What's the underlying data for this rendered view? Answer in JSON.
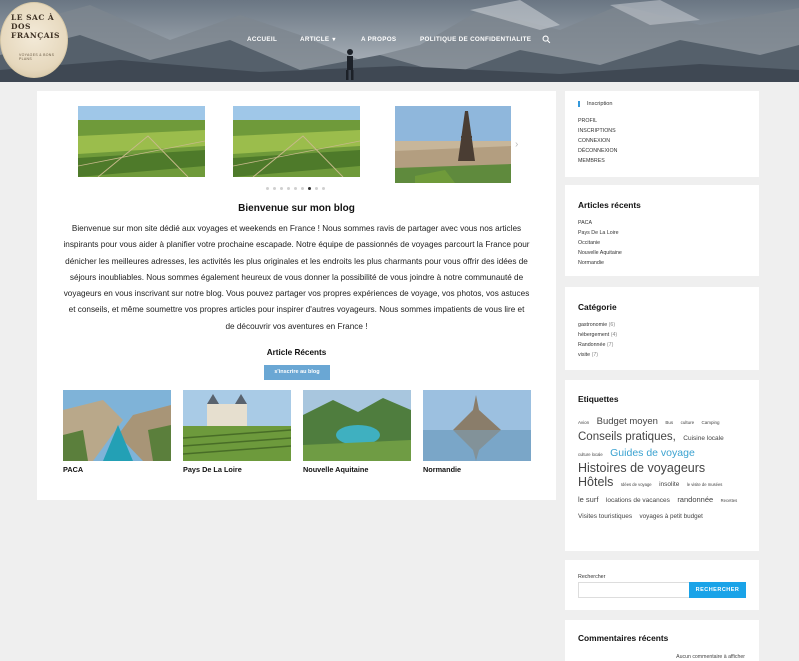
{
  "logo": {
    "text": "LE SAC À DOS FRANÇAIS",
    "subtitle": "VOYAGES & BONS PLANS"
  },
  "nav": {
    "items": [
      {
        "label": "ACCUEIL"
      },
      {
        "label": "ARTICLE"
      },
      {
        "label": "A PROPOS"
      },
      {
        "label": "POLITIQUE DE CONFIDENTIALITE"
      }
    ],
    "search_icon": "search-icon"
  },
  "main": {
    "slider": {
      "dot_count": 9,
      "active_dot": 6
    },
    "welcome_title": "Bienvenue sur mon blog",
    "welcome_text": "Bienvenue sur mon site dédié aux voyages et weekends en France ! Nous sommes ravis de partager avec vous nos articles inspirants pour vous aider à planifier votre prochaine escapade. Notre équipe de passionnés de voyages parcourt la France pour dénicher les meilleures adresses, les activités les plus originales et les endroits les plus charmants pour vous offrir des idées de séjours inoubliables. Nous sommes également heureux de vous donner la possibilité de vous joindre à notre communauté de voyageurs en vous inscrivant sur notre blog. Vous pouvez partager vos propres expériences de voyage, vos photos, vos astuces et conseils, et même soumettre vos propres articles pour inspirer d'autres voyageurs. Nous sommes impatients de vous lire et de découvrir vos aventures en France !",
    "recent_title": "Article Récents",
    "subscribe_label": "s'inscrire au blog",
    "articles": [
      {
        "label": "PACA"
      },
      {
        "label": "Pays De La Loire"
      },
      {
        "label": "Nouvelle Aquitaine"
      },
      {
        "label": "Normandie"
      }
    ]
  },
  "sidebar": {
    "inscription": {
      "title": "Inscription",
      "links": [
        "PROFIL",
        "INSCRIPTIONS",
        "CONNEXION",
        "DÉCONNEXION",
        "MEMBRES"
      ]
    },
    "recent_articles": {
      "title": "Articles récents",
      "items": [
        "PACA",
        "Pays De La Loire",
        "Occitanie",
        "Nouvelle Aquitaine",
        "Normandie"
      ]
    },
    "categories": {
      "title": "Catégorie",
      "items": [
        {
          "name": "gastronomie",
          "count": "(6)"
        },
        {
          "name": "hébergement",
          "count": "(4)"
        },
        {
          "name": "Randonnée",
          "count": "(7)"
        },
        {
          "name": "visite",
          "count": "(7)"
        }
      ]
    },
    "tags": {
      "title": "Etiquettes",
      "items": [
        {
          "label": "Avion",
          "size": 4.5
        },
        {
          "label": "Budget moyen",
          "size": 9.5
        },
        {
          "label": "Bus",
          "size": 4.5
        },
        {
          "label": "culture",
          "size": 4.5
        },
        {
          "label": "Camping",
          "size": 4.5
        },
        {
          "label": "Conseils pratiques,",
          "size": 11.5
        },
        {
          "label": "Cuisine locale",
          "size": 6.5
        },
        {
          "label": "culture locale",
          "size": 4.2
        },
        {
          "label": "Guides de voyage",
          "size": 10.5,
          "highlight": true
        },
        {
          "label": "Histoires de voyageurs",
          "size": 12.5
        },
        {
          "label": "Hôtels",
          "size": 12.5
        },
        {
          "label": "Idées de voyage",
          "size": 4.2
        },
        {
          "label": "insolite",
          "size": 6.5
        },
        {
          "label": "le visite de musées",
          "size": 4.2
        },
        {
          "label": "le surf",
          "size": 7.5
        },
        {
          "label": "locations de vacances",
          "size": 6.5
        },
        {
          "label": "randonnée",
          "size": 7.5
        },
        {
          "label": "Recettes",
          "size": 4.2
        },
        {
          "label": "Visites touristiques",
          "size": 6.5
        },
        {
          "label": "voyages à petit budget",
          "size": 6.3
        }
      ],
      "highlight_color": "#3aa2d0"
    },
    "search": {
      "label": "Rechercher",
      "placeholder": "",
      "button_label": "RECHERCHER"
    },
    "comments": {
      "title": "Commentaires récents",
      "empty_text": "Aucun commentaire à afficher"
    }
  },
  "colors": {
    "background": "#efefef",
    "accent": "#1aa3e8",
    "button": "#6aa7d4"
  }
}
